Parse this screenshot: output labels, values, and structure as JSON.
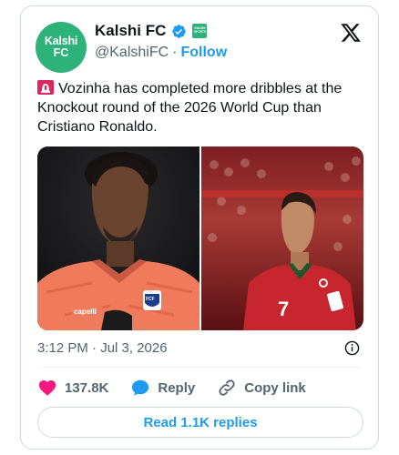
{
  "account": {
    "avatar_line1": "Kalshi",
    "avatar_line2": "FC",
    "display_name": "Kalshi FC",
    "handle": "@KalshiFC",
    "separator": "·",
    "follow_label": "Follow",
    "affiliate_badge_line1": "KALSHI",
    "affiliate_badge_line2": "SPORTS"
  },
  "tweet": {
    "text": "Vozinha has completed more dribbles at the Knockout round of the 2026 World Cup than Cristiano Ronaldo.",
    "leading_emoji": "siren-icon",
    "timestamp": "3:12 PM · Jul 3, 2026"
  },
  "media": {
    "left_jersey_sponsor": "capelli",
    "left_crest_text": "FCF",
    "right_jersey_number": "7"
  },
  "actions": {
    "like_count": "137.8K",
    "reply_label": "Reply",
    "copy_link_label": "Copy link",
    "read_replies_label": "Read 1.1K replies"
  },
  "colors": {
    "brand_green": "#2db37a",
    "twitter_blue": "#1d9bf0",
    "like_pink": "#f91880",
    "muted_text": "#536471"
  }
}
